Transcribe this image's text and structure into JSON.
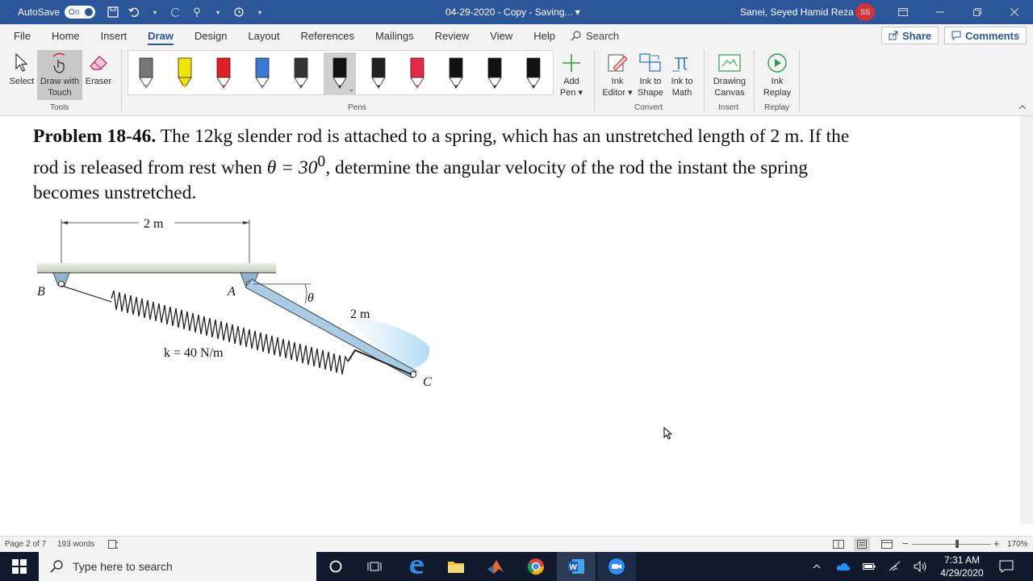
{
  "titlebar": {
    "autosave_label": "AutoSave",
    "autosave_state": "On",
    "doc_title": "04-29-2020 - Copy - Saving... ▾",
    "user_name": "Sanei, Seyed Hamid Reza",
    "user_initials": "SS"
  },
  "tabs": [
    "File",
    "Home",
    "Insert",
    "Draw",
    "Design",
    "Layout",
    "References",
    "Mailings",
    "Review",
    "View",
    "Help"
  ],
  "active_tab": "Draw",
  "tell_me": "Search",
  "share_label": "Share",
  "comments_label": "Comments",
  "ribbon": {
    "tools": {
      "select": "Select",
      "draw_touch_1": "Draw with",
      "draw_touch_2": "Touch",
      "eraser": "Eraser",
      "group": "Tools"
    },
    "pens_group": "Pens",
    "pen_colors": [
      "#777777",
      "#f2e600",
      "#e02020",
      "#3a78d6",
      "#333333",
      "#111111",
      "#222222",
      "#e8254a",
      "#111111",
      "#111111",
      "#111111"
    ],
    "add_pen_1": "Add",
    "add_pen_2": "Pen ▾",
    "convert": {
      "ink_editor_1": "Ink",
      "ink_editor_2": "Editor ▾",
      "ink_shape_1": "Ink to",
      "ink_shape_2": "Shape",
      "ink_math_1": "Ink to",
      "ink_math_2": "Math",
      "group": "Convert"
    },
    "insert": {
      "canvas_1": "Drawing",
      "canvas_2": "Canvas",
      "group": "Insert"
    },
    "replay": {
      "replay_1": "Ink",
      "replay_2": "Replay",
      "group": "Replay"
    }
  },
  "document": {
    "problem_label": "Problem 18-46.",
    "problem_text_1": " The 12kg slender rod is attached to a spring, which has an unstretched length of 2 m. If the",
    "problem_text_2a": "rod is released from rest when ",
    "theta_expr": "θ = 30",
    "theta_sup": "0",
    "problem_text_2b": ", determine the angular velocity of the rod the instant the spring",
    "problem_text_3": "becomes unstretched.",
    "figure": {
      "dim_top": "2 m",
      "label_b": "B",
      "label_a": "A",
      "label_c": "C",
      "label_theta": "θ",
      "rod_length": "2 m",
      "spring_k": "k = 40 N/m"
    }
  },
  "statusbar": {
    "page": "Page 2 of 7",
    "words": "193 words",
    "zoom": "170%"
  },
  "taskbar": {
    "search_placeholder": "Type here to search",
    "time": "7:31 AM",
    "date": "4/29/2020"
  }
}
